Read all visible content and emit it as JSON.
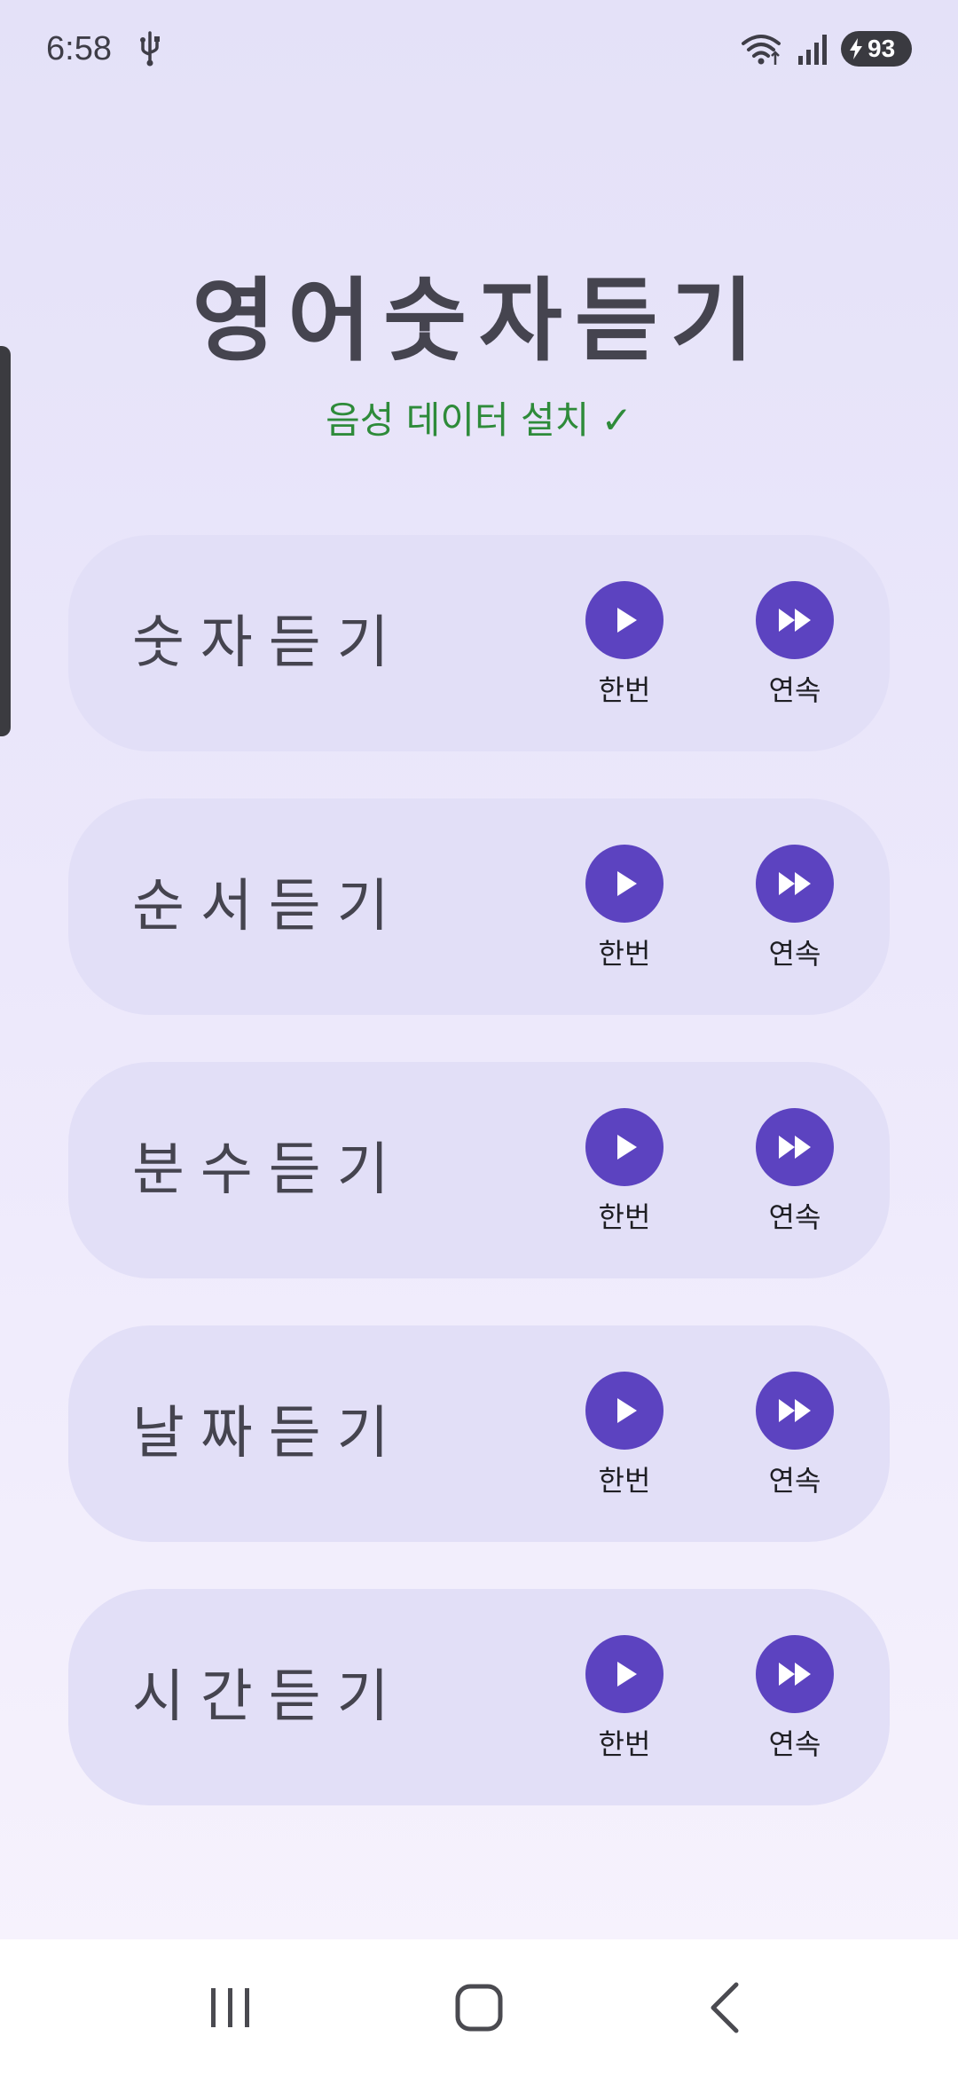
{
  "status_bar": {
    "time": "6:58",
    "battery_level": "93",
    "icons": [
      "usb-icon",
      "wifi-icon",
      "signal-icon",
      "battery-charging-icon"
    ]
  },
  "header": {
    "title": "영어숫자듣기",
    "subtitle": "음성 데이터 설치 ✓"
  },
  "colors": {
    "accent": "#5c43c0",
    "card_bg": "#e2dff7",
    "subtitle_green": "#2e8b3a",
    "text_dark": "#45444f"
  },
  "cards": [
    {
      "label": "숫자듣기",
      "once_label": "한번",
      "continuous_label": "연속"
    },
    {
      "label": "순서듣기",
      "once_label": "한번",
      "continuous_label": "연속"
    },
    {
      "label": "분수듣기",
      "once_label": "한번",
      "continuous_label": "연속"
    },
    {
      "label": "날짜듣기",
      "once_label": "한번",
      "continuous_label": "연속"
    },
    {
      "label": "시간듣기",
      "once_label": "한번",
      "continuous_label": "연속"
    }
  ],
  "nav_bar": {
    "icons": [
      "recents-icon",
      "home-icon",
      "back-icon"
    ]
  }
}
